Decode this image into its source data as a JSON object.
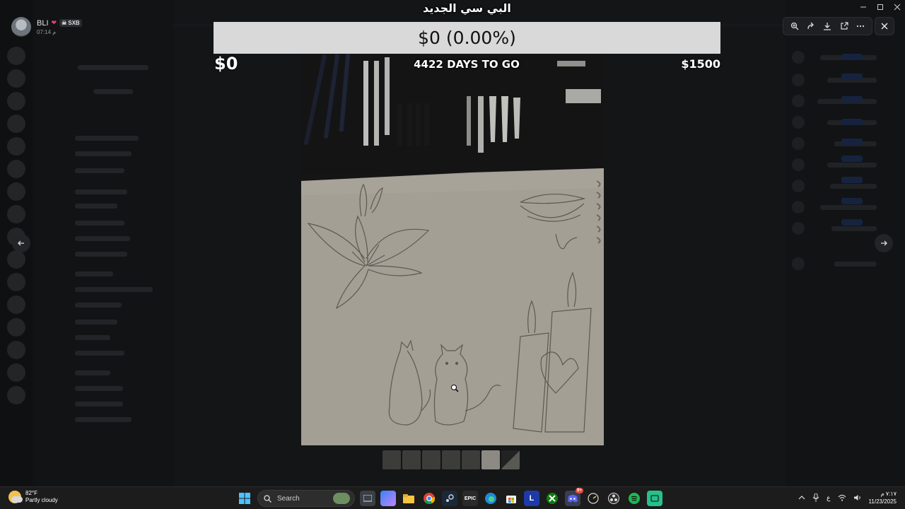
{
  "user": {
    "name": "BLI",
    "tag": "SXB",
    "time": "07:14 م"
  },
  "overlay": {
    "title": "البي سي الجديد",
    "progress_text": "$0 (0.00%)",
    "progress_fraction": 0.0,
    "goal_min": "$0",
    "goal_max": "$1500",
    "days_left": "4422 DAYS TO GO"
  },
  "viewer_tools": [
    "zoom-in-icon",
    "forward-icon",
    "download-icon",
    "open-external-icon",
    "more-icon"
  ],
  "thumbnails": {
    "count": 7,
    "active_index": 5
  },
  "taskbar": {
    "weather_temp": "82°F",
    "weather_desc": "Partly cloudy",
    "search_placeholder": "Search",
    "discord_badge": "9+",
    "lang": "ع",
    "clock_time": "٧:١٧ م",
    "clock_date": "11/23/2025",
    "app_labels": {
      "epic": "EPIC",
      "launcher": "L"
    }
  },
  "colors": {
    "progress_track": "#d9d9d9",
    "progress_fill": "#4caf50",
    "taskbar": "#1c1c1c",
    "discord": "#5865f2"
  }
}
